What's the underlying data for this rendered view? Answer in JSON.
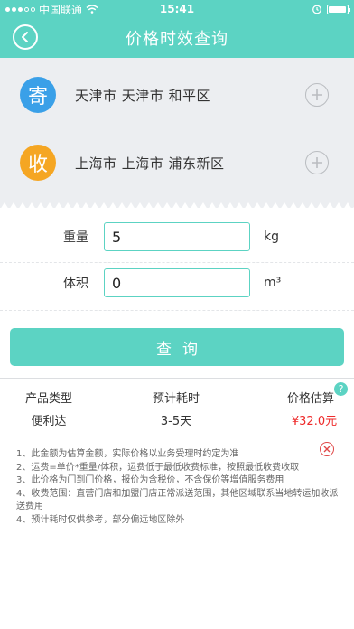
{
  "status_bar": {
    "carrier": "中国联通",
    "time": "15:41",
    "battery_level": 0.95
  },
  "nav": {
    "title": "价格时效查询",
    "back_icon": "chevron-left-icon"
  },
  "sender": {
    "badge": "寄",
    "badge_color": "#3aa0e8",
    "address": "天津市 天津市 和平区"
  },
  "receiver": {
    "badge": "收",
    "badge_color": "#f5a623",
    "address": "上海市 上海市 浦东新区"
  },
  "form": {
    "weight_label": "重量",
    "weight_value": "5",
    "weight_unit": "kg",
    "volume_label": "体积",
    "volume_value": "0",
    "volume_unit": "m³"
  },
  "query_button": "查询",
  "result": {
    "headers": [
      "产品类型",
      "预计耗时",
      "价格估算"
    ],
    "rows": [
      {
        "product": "便利达",
        "time": "3-5天",
        "price": "¥32.0元"
      }
    ],
    "help": "?"
  },
  "notes": [
    "1、此金额为估算金额，实际价格以业务受理时约定为准",
    "2、运费=单价*重量/体积，运费低于最低收费标准，按照最低收费收取",
    "3、此价格为门到门价格，报价为含税价，不含保价等增值服务费用",
    "4、收费范围：直营门店和加盟门店正常派送范围，其他区域联系当地转运加收派送费用",
    "4、预计耗时仅供参考，部分偏远地区除外"
  ],
  "colors": {
    "accent": "#5cd3c3",
    "price": "#ee2b2b"
  }
}
